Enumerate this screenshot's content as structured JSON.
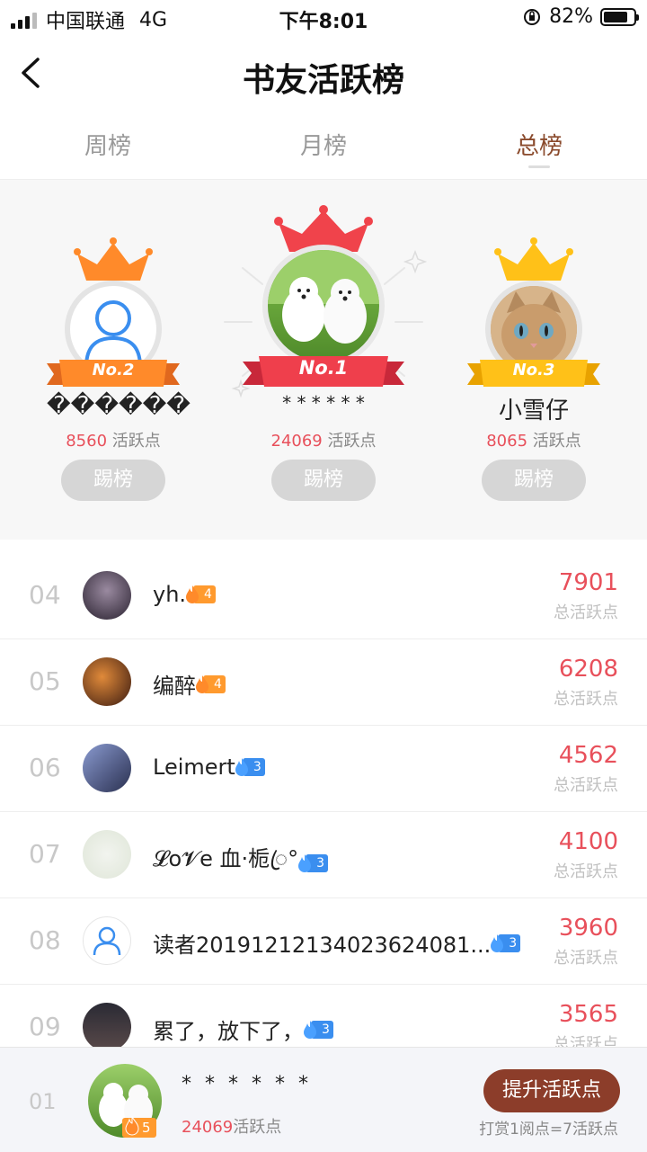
{
  "statusbar": {
    "carrier": "中国联通",
    "network": "4G",
    "time": "下午8:01",
    "battery": "82%"
  },
  "header": {
    "title": "书友活跃榜",
    "back_icon": "chevron-left-icon"
  },
  "tabs": [
    {
      "label": "周榜",
      "active": false
    },
    {
      "label": "月榜",
      "active": false
    },
    {
      "label": "总榜",
      "active": true
    }
  ],
  "podium": {
    "first": {
      "badge": "No.1",
      "name": "* * * * * *",
      "points": "24069",
      "points_label": "活跃点",
      "button": "踢榜"
    },
    "second": {
      "badge": "No.2",
      "name": "������",
      "points": "8560",
      "points_label": "活跃点",
      "button": "踢榜"
    },
    "third": {
      "badge": "No.3",
      "name": "小雪仔",
      "points": "8065",
      "points_label": "活跃点",
      "button": "踢榜"
    }
  },
  "list": [
    {
      "rank": "04",
      "name": "yh.",
      "level": "4",
      "level_color": "#ff9a2e",
      "score": "7901",
      "score_label": "总活跃点"
    },
    {
      "rank": "05",
      "name": "编醉",
      "level": "4",
      "level_color": "#ff9a2e",
      "score": "6208",
      "score_label": "总活跃点"
    },
    {
      "rank": "06",
      "name": "Leimert",
      "level": "3",
      "level_color": "#3a8eef",
      "score": "4562",
      "score_label": "总活跃点"
    },
    {
      "rank": "07",
      "name": "𝓛o𝓥e 血·栀ꦿ°",
      "level": "3",
      "level_color": "#3a8eef",
      "score": "4100",
      "score_label": "总活跃点"
    },
    {
      "rank": "08",
      "name": "读者2019121213402362408​1...",
      "level": "3",
      "level_color": "#3a8eef",
      "score": "3960",
      "score_label": "总活跃点"
    },
    {
      "rank": "09",
      "name": "累了，放下了，",
      "level": "3",
      "level_color": "#3a8eef",
      "score": "3565",
      "score_label": "总活跃点"
    }
  ],
  "me": {
    "rank": "01",
    "name": "* * * * * *",
    "level": "5",
    "points": "24069",
    "points_label": "活跃点",
    "boost_button": "提升活跃点",
    "hint": "打赏1阅点=7活跃点"
  }
}
